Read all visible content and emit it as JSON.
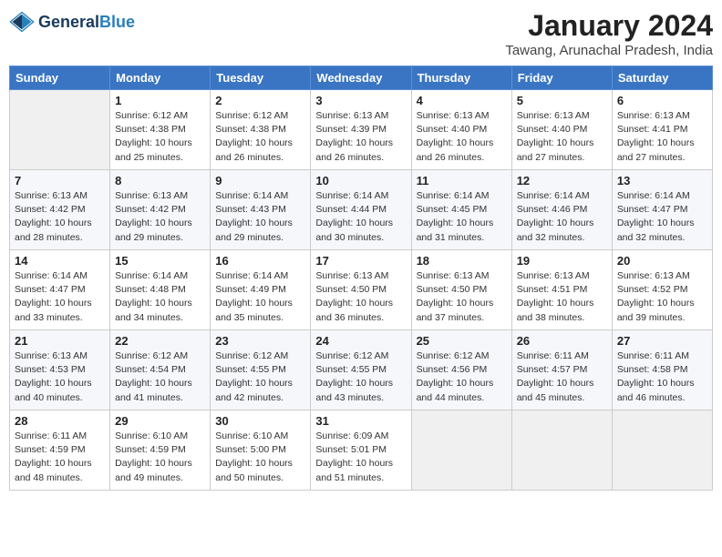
{
  "header": {
    "logo_line1": "General",
    "logo_line2": "Blue",
    "month_title": "January 2024",
    "location": "Tawang, Arunachal Pradesh, India"
  },
  "weekdays": [
    "Sunday",
    "Monday",
    "Tuesday",
    "Wednesday",
    "Thursday",
    "Friday",
    "Saturday"
  ],
  "weeks": [
    [
      {
        "day": "",
        "sunrise": "",
        "sunset": "",
        "daylight": ""
      },
      {
        "day": "1",
        "sunrise": "Sunrise: 6:12 AM",
        "sunset": "Sunset: 4:38 PM",
        "daylight": "Daylight: 10 hours and 25 minutes."
      },
      {
        "day": "2",
        "sunrise": "Sunrise: 6:12 AM",
        "sunset": "Sunset: 4:38 PM",
        "daylight": "Daylight: 10 hours and 26 minutes."
      },
      {
        "day": "3",
        "sunrise": "Sunrise: 6:13 AM",
        "sunset": "Sunset: 4:39 PM",
        "daylight": "Daylight: 10 hours and 26 minutes."
      },
      {
        "day": "4",
        "sunrise": "Sunrise: 6:13 AM",
        "sunset": "Sunset: 4:40 PM",
        "daylight": "Daylight: 10 hours and 26 minutes."
      },
      {
        "day": "5",
        "sunrise": "Sunrise: 6:13 AM",
        "sunset": "Sunset: 4:40 PM",
        "daylight": "Daylight: 10 hours and 27 minutes."
      },
      {
        "day": "6",
        "sunrise": "Sunrise: 6:13 AM",
        "sunset": "Sunset: 4:41 PM",
        "daylight": "Daylight: 10 hours and 27 minutes."
      }
    ],
    [
      {
        "day": "7",
        "sunrise": "Sunrise: 6:13 AM",
        "sunset": "Sunset: 4:42 PM",
        "daylight": "Daylight: 10 hours and 28 minutes."
      },
      {
        "day": "8",
        "sunrise": "Sunrise: 6:13 AM",
        "sunset": "Sunset: 4:42 PM",
        "daylight": "Daylight: 10 hours and 29 minutes."
      },
      {
        "day": "9",
        "sunrise": "Sunrise: 6:14 AM",
        "sunset": "Sunset: 4:43 PM",
        "daylight": "Daylight: 10 hours and 29 minutes."
      },
      {
        "day": "10",
        "sunrise": "Sunrise: 6:14 AM",
        "sunset": "Sunset: 4:44 PM",
        "daylight": "Daylight: 10 hours and 30 minutes."
      },
      {
        "day": "11",
        "sunrise": "Sunrise: 6:14 AM",
        "sunset": "Sunset: 4:45 PM",
        "daylight": "Daylight: 10 hours and 31 minutes."
      },
      {
        "day": "12",
        "sunrise": "Sunrise: 6:14 AM",
        "sunset": "Sunset: 4:46 PM",
        "daylight": "Daylight: 10 hours and 32 minutes."
      },
      {
        "day": "13",
        "sunrise": "Sunrise: 6:14 AM",
        "sunset": "Sunset: 4:47 PM",
        "daylight": "Daylight: 10 hours and 32 minutes."
      }
    ],
    [
      {
        "day": "14",
        "sunrise": "Sunrise: 6:14 AM",
        "sunset": "Sunset: 4:47 PM",
        "daylight": "Daylight: 10 hours and 33 minutes."
      },
      {
        "day": "15",
        "sunrise": "Sunrise: 6:14 AM",
        "sunset": "Sunset: 4:48 PM",
        "daylight": "Daylight: 10 hours and 34 minutes."
      },
      {
        "day": "16",
        "sunrise": "Sunrise: 6:14 AM",
        "sunset": "Sunset: 4:49 PM",
        "daylight": "Daylight: 10 hours and 35 minutes."
      },
      {
        "day": "17",
        "sunrise": "Sunrise: 6:13 AM",
        "sunset": "Sunset: 4:50 PM",
        "daylight": "Daylight: 10 hours and 36 minutes."
      },
      {
        "day": "18",
        "sunrise": "Sunrise: 6:13 AM",
        "sunset": "Sunset: 4:50 PM",
        "daylight": "Daylight: 10 hours and 37 minutes."
      },
      {
        "day": "19",
        "sunrise": "Sunrise: 6:13 AM",
        "sunset": "Sunset: 4:51 PM",
        "daylight": "Daylight: 10 hours and 38 minutes."
      },
      {
        "day": "20",
        "sunrise": "Sunrise: 6:13 AM",
        "sunset": "Sunset: 4:52 PM",
        "daylight": "Daylight: 10 hours and 39 minutes."
      }
    ],
    [
      {
        "day": "21",
        "sunrise": "Sunrise: 6:13 AM",
        "sunset": "Sunset: 4:53 PM",
        "daylight": "Daylight: 10 hours and 40 minutes."
      },
      {
        "day": "22",
        "sunrise": "Sunrise: 6:12 AM",
        "sunset": "Sunset: 4:54 PM",
        "daylight": "Daylight: 10 hours and 41 minutes."
      },
      {
        "day": "23",
        "sunrise": "Sunrise: 6:12 AM",
        "sunset": "Sunset: 4:55 PM",
        "daylight": "Daylight: 10 hours and 42 minutes."
      },
      {
        "day": "24",
        "sunrise": "Sunrise: 6:12 AM",
        "sunset": "Sunset: 4:55 PM",
        "daylight": "Daylight: 10 hours and 43 minutes."
      },
      {
        "day": "25",
        "sunrise": "Sunrise: 6:12 AM",
        "sunset": "Sunset: 4:56 PM",
        "daylight": "Daylight: 10 hours and 44 minutes."
      },
      {
        "day": "26",
        "sunrise": "Sunrise: 6:11 AM",
        "sunset": "Sunset: 4:57 PM",
        "daylight": "Daylight: 10 hours and 45 minutes."
      },
      {
        "day": "27",
        "sunrise": "Sunrise: 6:11 AM",
        "sunset": "Sunset: 4:58 PM",
        "daylight": "Daylight: 10 hours and 46 minutes."
      }
    ],
    [
      {
        "day": "28",
        "sunrise": "Sunrise: 6:11 AM",
        "sunset": "Sunset: 4:59 PM",
        "daylight": "Daylight: 10 hours and 48 minutes."
      },
      {
        "day": "29",
        "sunrise": "Sunrise: 6:10 AM",
        "sunset": "Sunset: 4:59 PM",
        "daylight": "Daylight: 10 hours and 49 minutes."
      },
      {
        "day": "30",
        "sunrise": "Sunrise: 6:10 AM",
        "sunset": "Sunset: 5:00 PM",
        "daylight": "Daylight: 10 hours and 50 minutes."
      },
      {
        "day": "31",
        "sunrise": "Sunrise: 6:09 AM",
        "sunset": "Sunset: 5:01 PM",
        "daylight": "Daylight: 10 hours and 51 minutes."
      },
      {
        "day": "",
        "sunrise": "",
        "sunset": "",
        "daylight": ""
      },
      {
        "day": "",
        "sunrise": "",
        "sunset": "",
        "daylight": ""
      },
      {
        "day": "",
        "sunrise": "",
        "sunset": "",
        "daylight": ""
      }
    ]
  ]
}
